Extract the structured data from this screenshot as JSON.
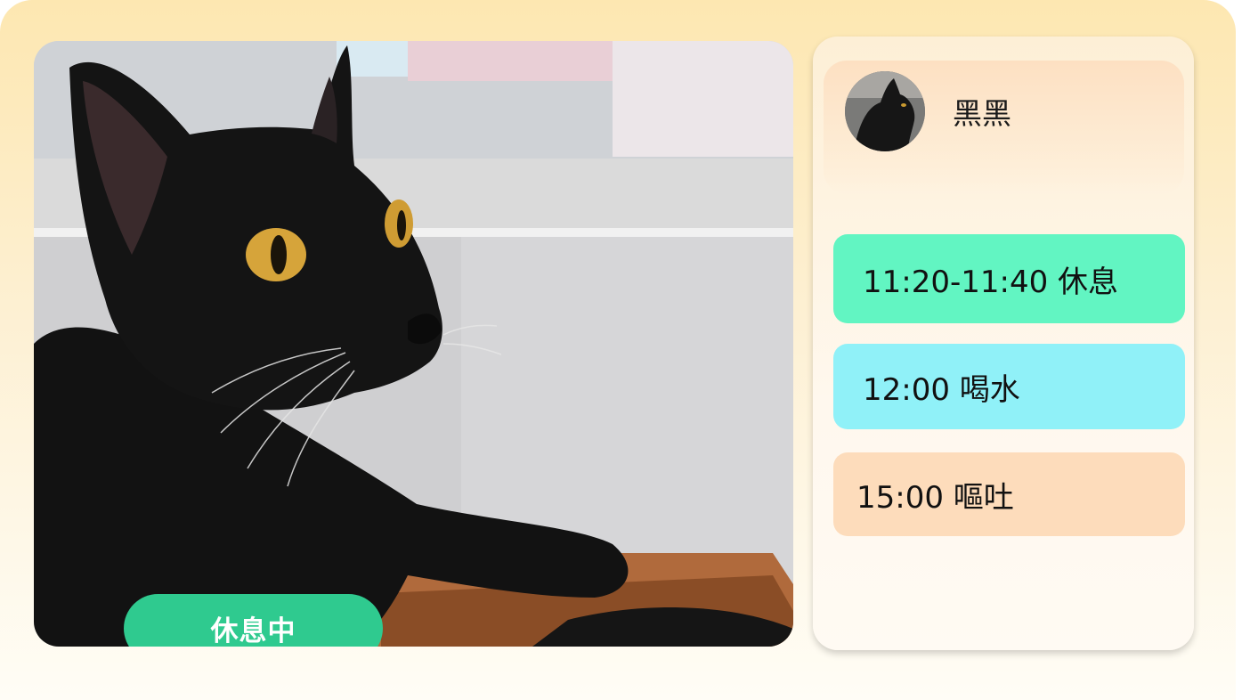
{
  "photo": {
    "alt_subject": "black cat",
    "status_label": "休息中",
    "status_color": "#2fca8f"
  },
  "profile": {
    "name": "黑黑"
  },
  "events": [
    {
      "label": "11:20-11:40 休息",
      "color": "#62f5c2"
    },
    {
      "label": "12:00 喝水",
      "color": "#90f1f8"
    },
    {
      "label": "15:00 嘔吐",
      "color": "#fddcbb"
    }
  ],
  "colors": {
    "background_top": "#fde7b1",
    "background_bottom": "#fffdf6",
    "panel": "#fff8ee"
  }
}
